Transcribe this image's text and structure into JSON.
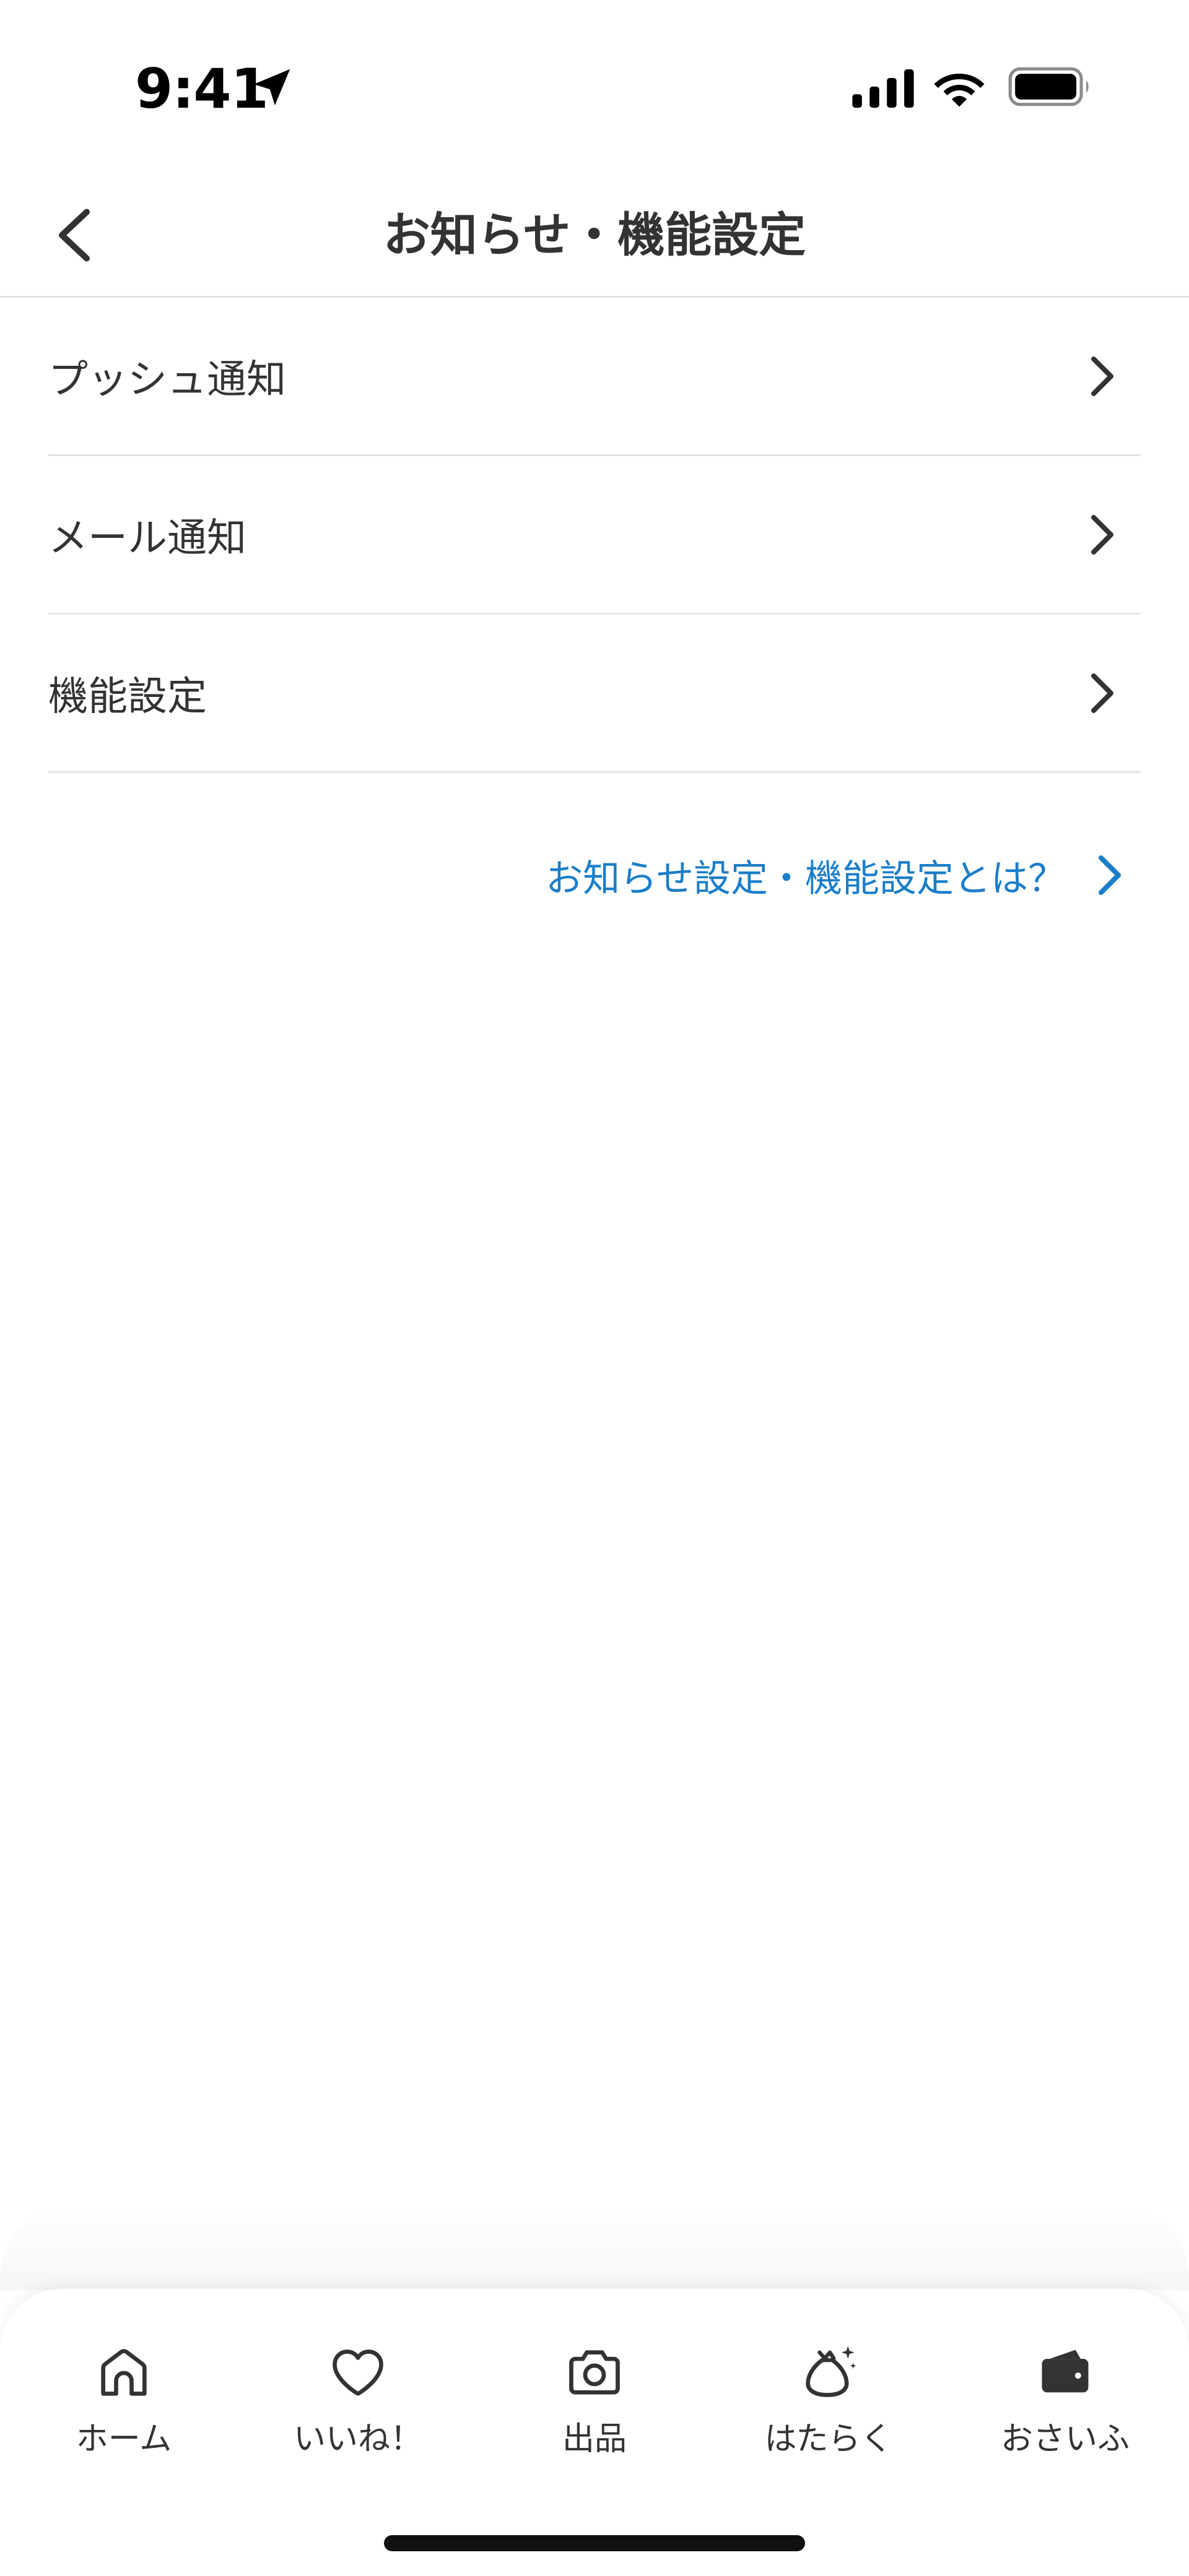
{
  "status_bar": {
    "time": "9:41",
    "icons": [
      "location-arrow-icon",
      "cellular-signal-icon",
      "wifi-icon",
      "battery-icon"
    ]
  },
  "header": {
    "title": "お知らせ・機能設定",
    "back_icon": "chevron-left-icon"
  },
  "menu": {
    "items": [
      {
        "label": "プッシュ通知"
      },
      {
        "label": "メール通知"
      },
      {
        "label": "機能設定"
      }
    ]
  },
  "help_link": {
    "label": "お知らせ設定・機能設定とは？"
  },
  "tab_bar": {
    "tabs": [
      {
        "label": "ホーム",
        "icon": "home-icon"
      },
      {
        "label": "いいね！",
        "icon": "heart-icon"
      },
      {
        "label": "出品",
        "icon": "camera-icon"
      },
      {
        "label": "はたらく",
        "icon": "money-bag-icon"
      },
      {
        "label": "おさいふ",
        "icon": "wallet-icon"
      }
    ]
  },
  "colors": {
    "text": "#333333",
    "link": "#1a7ec9",
    "divider": "#e3e3e3",
    "background": "#ffffff"
  }
}
